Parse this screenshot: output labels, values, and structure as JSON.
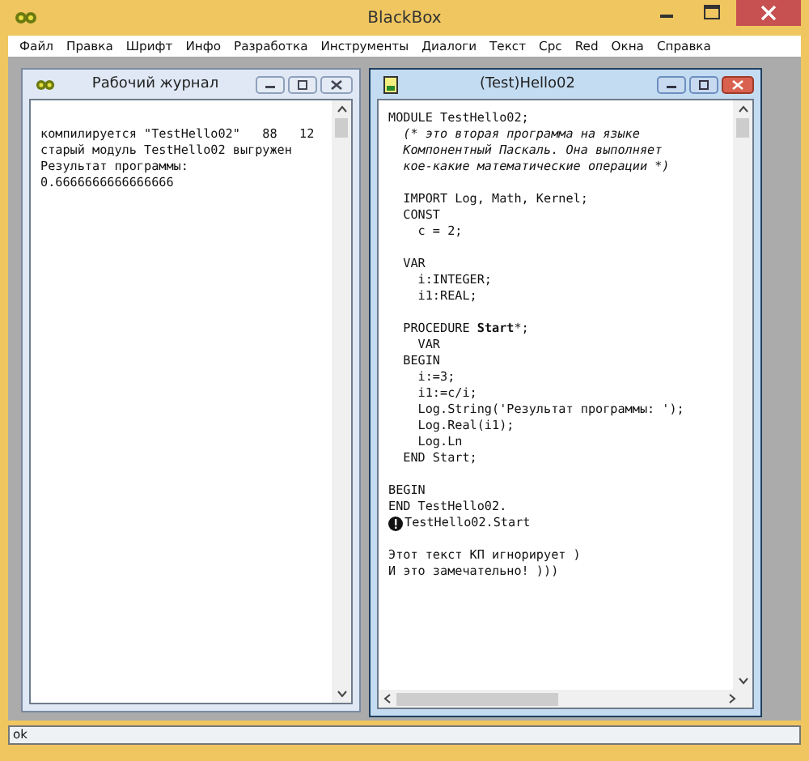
{
  "window": {
    "title": "BlackBox"
  },
  "menu": [
    "Файл",
    "Правка",
    "Шрифт",
    "Инфо",
    "Разработка",
    "Инструменты",
    "Диалоги",
    "Текст",
    "Cpc",
    "Red",
    "Окна",
    "Справка"
  ],
  "log_window": {
    "title": "Рабочий журнал",
    "active": false,
    "lines": [
      "компилируется \"TestHello02\"   88   12",
      "старый модуль TestHello02 выгружен",
      "Результат программы:",
      "0.6666666666666666"
    ]
  },
  "editor_window": {
    "title": "(Test)Hello02",
    "active": true,
    "lines": [
      {
        "kind": "code",
        "text": "MODULE TestHello02;"
      },
      {
        "kind": "comment",
        "text": "  (* это вторая программа на языке"
      },
      {
        "kind": "comment",
        "text": "  Компонентный Паскаль. Она выполняет"
      },
      {
        "kind": "comment",
        "text": "  кое-какие математические операции *)"
      },
      {
        "kind": "blank"
      },
      {
        "kind": "code",
        "text": "  IMPORT Log, Math, Kernel;"
      },
      {
        "kind": "code",
        "text": "  CONST"
      },
      {
        "kind": "code",
        "text": "    c = 2;"
      },
      {
        "kind": "blank"
      },
      {
        "kind": "code",
        "text": "  VAR"
      },
      {
        "kind": "code",
        "text": "    i:INTEGER;"
      },
      {
        "kind": "code",
        "text": "    i1:REAL;"
      },
      {
        "kind": "blank"
      },
      {
        "kind": "code",
        "text": "  PROCEDURE **Start***;"
      },
      {
        "kind": "code",
        "text": "    VAR"
      },
      {
        "kind": "code",
        "text": "  BEGIN"
      },
      {
        "kind": "code",
        "text": "    i:=3;"
      },
      {
        "kind": "code",
        "text": "    i1:=c/i;"
      },
      {
        "kind": "code",
        "text": "    Log.String('Результат программы: ');"
      },
      {
        "kind": "code",
        "text": "    Log.Real(i1);"
      },
      {
        "kind": "code",
        "text": "    Log.Ln"
      },
      {
        "kind": "code",
        "text": "  END Start;"
      },
      {
        "kind": "blank"
      },
      {
        "kind": "code",
        "text": "BEGIN"
      },
      {
        "kind": "code",
        "text": "END TestHello02."
      },
      {
        "kind": "command",
        "text": "TestHello02.Start"
      },
      {
        "kind": "blank"
      },
      {
        "kind": "code",
        "text": "Этот текст КП игнорирует )"
      },
      {
        "kind": "code",
        "text": "И это замечательно! )))"
      }
    ]
  },
  "status_bar": {
    "text": "ok"
  }
}
